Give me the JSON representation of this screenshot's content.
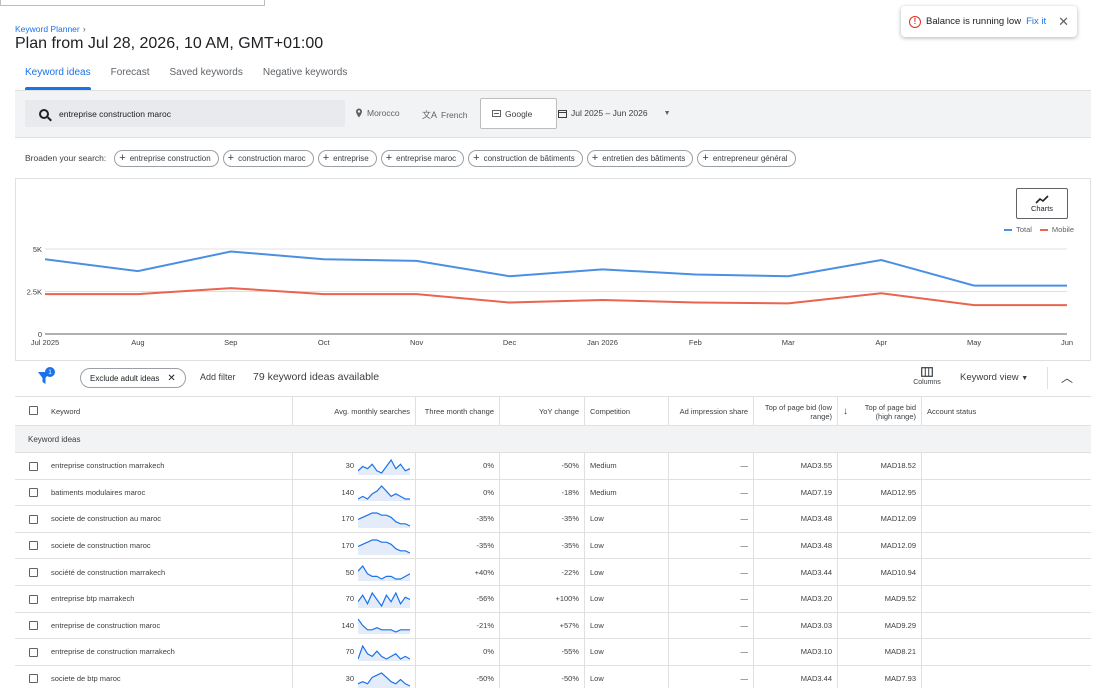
{
  "breadcrumb": "Keyword Planner",
  "page_title": "Plan from Jul 28, 2026, 10 AM, GMT+01:00",
  "tabs": [
    "Keyword ideas",
    "Forecast",
    "Saved keywords",
    "Negative keywords"
  ],
  "toast": {
    "message": "Balance is running low",
    "link": "Fix it"
  },
  "search": {
    "query": "entreprise construction maroc",
    "location": "Morocco",
    "language": "French",
    "network": "Google",
    "date_range": "Jul 2025 – Jun 2026"
  },
  "broaden": {
    "label": "Broaden your search:",
    "chips": [
      "entreprise construction",
      "construction maroc",
      "entreprise",
      "entreprise maroc",
      "construction de bâtiments",
      "entretien des bâtiments",
      "entrepreneur général"
    ]
  },
  "charts_button": "Charts",
  "colors": {
    "total": "#4a90e2",
    "mobile": "#e8654f",
    "accent": "#1a73e8"
  },
  "chart_data": {
    "type": "line",
    "x": [
      "Jul 2025",
      "Aug",
      "Sep",
      "Oct",
      "Nov",
      "Dec",
      "Jan 2026",
      "Feb",
      "Mar",
      "Apr",
      "May",
      "Jun"
    ],
    "series": [
      {
        "name": "Total",
        "values": [
          4400,
          3700,
          4850,
          4400,
          4300,
          3400,
          3800,
          3500,
          3400,
          4350,
          2850,
          2850
        ]
      },
      {
        "name": "Mobile",
        "values": [
          2350,
          2350,
          2700,
          2350,
          2350,
          1850,
          2000,
          1850,
          1800,
          2400,
          1700,
          1700
        ]
      }
    ],
    "yticks": [
      "0",
      "2.5K",
      "5K"
    ],
    "ylim": [
      0,
      5000
    ],
    "legend": "top-right"
  },
  "toolbar": {
    "filter_count": "1",
    "exclude_chip": "Exclude adult ideas",
    "add_filter": "Add filter",
    "count": "79 keyword ideas available",
    "columns": "Columns",
    "view": "Keyword view"
  },
  "table": {
    "headers": {
      "keyword": "Keyword",
      "avg": "Avg. monthly searches",
      "three": "Three month change",
      "yoy": "YoY change",
      "comp": "Competition",
      "ad": "Ad impression share",
      "low": "Top of page bid (low range)",
      "high": "Top of page bid (high range)",
      "status": "Account status"
    },
    "group_label": "Keyword ideas",
    "rows": [
      {
        "keyword": "entreprise construction marrakech",
        "avg": "30",
        "three": "0%",
        "yoy": "-50%",
        "comp": "Medium",
        "ad": "—",
        "low": "MAD3.55",
        "high": "MAD18.52",
        "trend": [
          3,
          5,
          4,
          6,
          3,
          2,
          5,
          8,
          4,
          6,
          3,
          4
        ]
      },
      {
        "keyword": "batiments modulaires maroc",
        "avg": "140",
        "three": "0%",
        "yoy": "-18%",
        "comp": "Medium",
        "ad": "—",
        "low": "MAD7.19",
        "high": "MAD12.95",
        "trend": [
          3,
          4,
          3,
          5,
          6,
          8,
          6,
          4,
          5,
          4,
          3,
          3
        ]
      },
      {
        "keyword": "societe de construction au maroc",
        "avg": "170",
        "three": "-35%",
        "yoy": "-35%",
        "comp": "Low",
        "ad": "—",
        "low": "MAD3.48",
        "high": "MAD12.09",
        "trend": [
          5,
          6,
          7,
          8,
          8,
          7,
          7,
          6,
          4,
          3,
          3,
          2
        ]
      },
      {
        "keyword": "societe de construction maroc",
        "avg": "170",
        "three": "-35%",
        "yoy": "-35%",
        "comp": "Low",
        "ad": "—",
        "low": "MAD3.48",
        "high": "MAD12.09",
        "trend": [
          5,
          6,
          7,
          8,
          8,
          7,
          7,
          6,
          4,
          3,
          3,
          2
        ]
      },
      {
        "keyword": "société de construction marrakech",
        "avg": "50",
        "three": "+40%",
        "yoy": "-22%",
        "comp": "Low",
        "ad": "—",
        "low": "MAD3.44",
        "high": "MAD10.94",
        "trend": [
          6,
          8,
          5,
          4,
          4,
          3,
          4,
          4,
          3,
          3,
          4,
          5
        ]
      },
      {
        "keyword": "entreprise btp marrakech",
        "avg": "70",
        "three": "-56%",
        "yoy": "+100%",
        "comp": "Low",
        "ad": "—",
        "low": "MAD3.20",
        "high": "MAD9.52",
        "trend": [
          4,
          7,
          3,
          8,
          5,
          2,
          7,
          4,
          8,
          3,
          6,
          5
        ]
      },
      {
        "keyword": "entreprise de construction maroc",
        "avg": "140",
        "three": "-21%",
        "yoy": "+57%",
        "comp": "Low",
        "ad": "—",
        "low": "MAD3.03",
        "high": "MAD9.29",
        "trend": [
          8,
          5,
          3,
          3,
          4,
          3,
          3,
          3,
          2,
          3,
          3,
          3
        ]
      },
      {
        "keyword": "entreprise de construction marrakech",
        "avg": "70",
        "three": "0%",
        "yoy": "-55%",
        "comp": "Low",
        "ad": "—",
        "low": "MAD3.10",
        "high": "MAD8.21",
        "trend": [
          3,
          8,
          5,
          4,
          6,
          4,
          3,
          4,
          5,
          3,
          4,
          3
        ]
      },
      {
        "keyword": "societe de btp maroc",
        "avg": "30",
        "three": "-50%",
        "yoy": "-50%",
        "comp": "Low",
        "ad": "—",
        "low": "MAD3.44",
        "high": "MAD7.93",
        "trend": [
          3,
          4,
          3,
          6,
          7,
          8,
          6,
          4,
          3,
          5,
          3,
          2
        ]
      }
    ]
  }
}
